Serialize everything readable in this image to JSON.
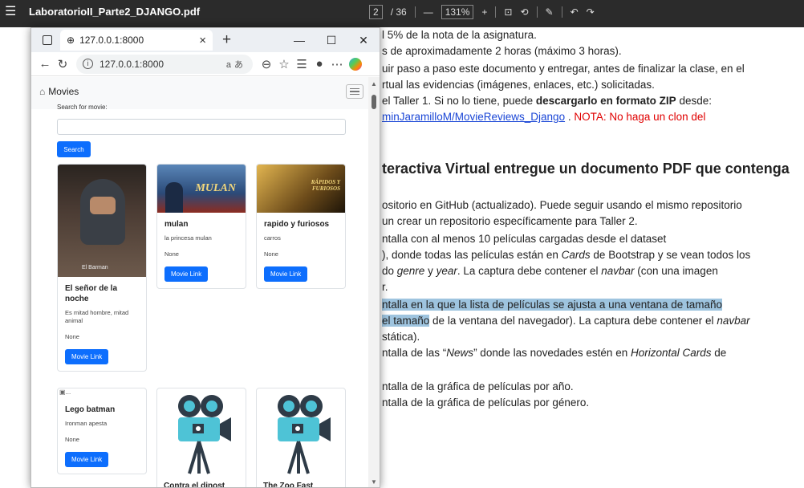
{
  "pdf": {
    "filename": "LaboratorioII_Parte2_DJANGO.pdf",
    "page_current": "2",
    "page_total": "/ 36",
    "zoom": "131%",
    "lines": [
      "l 5% de la nota de la asignatura.",
      "s de aproximadamente 2 horas (máximo 3 horas).",
      "uir paso a paso este documento y entregar, antes de finalizar la clase, en el",
      "rtual las evidencias (imágenes, enlaces, etc.) solicitadas.",
      "el Taller 1. Si no lo tiene, puede ",
      "descargarlo en formato ZIP",
      " desde:",
      "minJaramilloM/MovieReviews_Django",
      " . ",
      "NOTA: No haga un clon del",
      "teractiva Virtual entregue un documento PDF que contenga",
      "ositorio en GitHub (actualizado). Puede seguir usando el mismo repositorio",
      "un crear un repositorio específicamente para Taller 2.",
      "ntalla con al menos 10 películas cargadas desde el dataset",
      "), donde todas las películas están en ",
      "Cards",
      " de Bootstrap y se vean todos los",
      "do ",
      "genre",
      " y ",
      "year",
      ". La captura debe contener el ",
      "navbar",
      " (con una imagen",
      "r.",
      "ntalla en la que la lista de películas se ajusta a una ventana de tamaño",
      "el tamaño",
      " de la ventana del navegador). La captura debe contener el ",
      "navbar",
      "stática).",
      "ntalla de las “",
      "News",
      "” donde las novedades estén en ",
      "Horizontal Cards",
      " de",
      "ntalla de la gráfica de películas por año.",
      "ntalla de la gráfica de películas por género."
    ]
  },
  "browser": {
    "tab_title": "127.0.0.1:8000",
    "url": "127.0.0.1:8000",
    "reader_mode": "aあ"
  },
  "app": {
    "brand": "Movies",
    "search_label": "Search for movie:",
    "search_placeholder": "",
    "search_button": "Search",
    "movies": [
      {
        "title": "El señor de la noche",
        "description": "Es mitad hombre, mitad animal",
        "genre": "None",
        "link": "Movie Link",
        "image_caption": "El Barman"
      },
      {
        "title": "mulan",
        "description": "la princesa mulan",
        "genre": "None",
        "link": "Movie Link",
        "image_caption": "MULAN"
      },
      {
        "title": "rapido y furiosos",
        "description": "carros",
        "genre": "None",
        "link": "Movie Link",
        "image_caption": "RÁPIDOS Y FURIOSOS"
      },
      {
        "title": "Lego batman",
        "description": "Ironman apesta",
        "genre": "None",
        "link": "Movie Link",
        "image_caption": "..."
      },
      {
        "title": "Contra el dinost",
        "description": "",
        "genre": "",
        "link": ""
      },
      {
        "title": "The Zoo Fast",
        "description": "",
        "genre": "",
        "link": ""
      }
    ]
  }
}
